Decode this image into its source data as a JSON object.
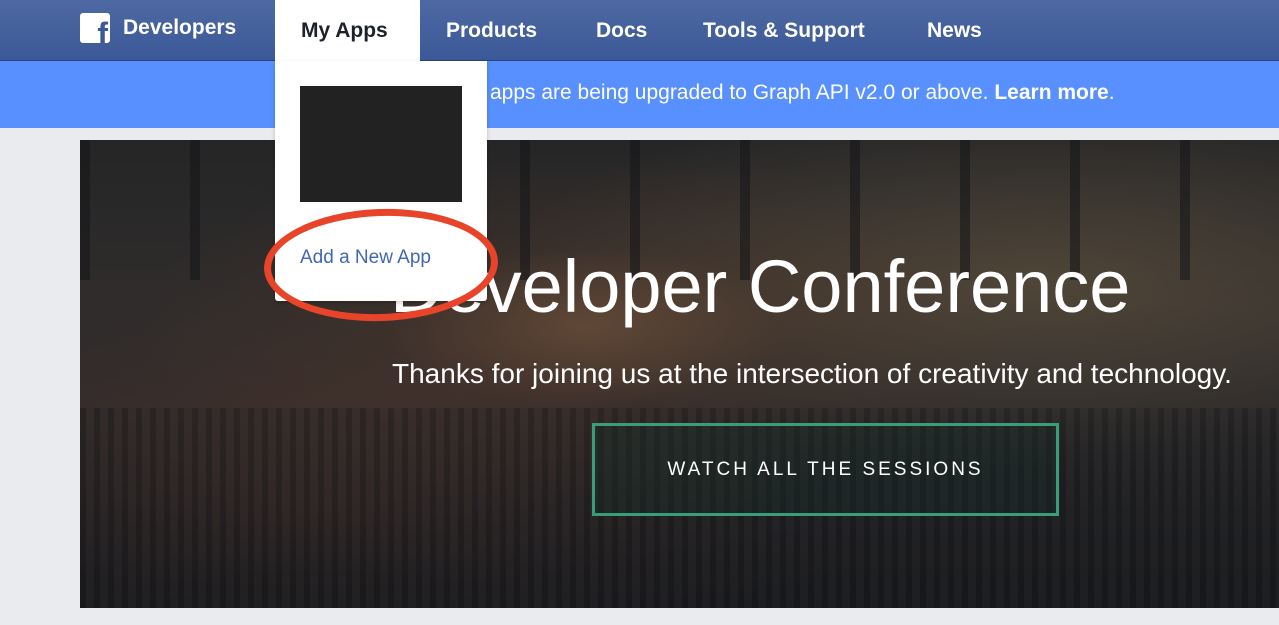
{
  "nav": {
    "brand": "Developers",
    "brand_icon": "facebook-f-icon",
    "items": [
      "My Apps",
      "Products",
      "Docs",
      "Tools & Support",
      "News"
    ]
  },
  "banner": {
    "text": "apps are being upgraded to Graph API v2.0 or above.",
    "link": "Learn more",
    "suffix": "."
  },
  "dropdown": {
    "add_app": "Add a New App"
  },
  "hero": {
    "title": "Developer Conference",
    "subtitle": "Thanks for joining us at the intersection of creativity and technology.",
    "cta": "WATCH ALL THE SESSIONS"
  },
  "colors": {
    "nav_bg": "#3b5998",
    "banner_bg": "#5890ff",
    "cta_border": "#3a9d7a",
    "highlight_ring": "#e8442a",
    "link": "#4267b2"
  }
}
